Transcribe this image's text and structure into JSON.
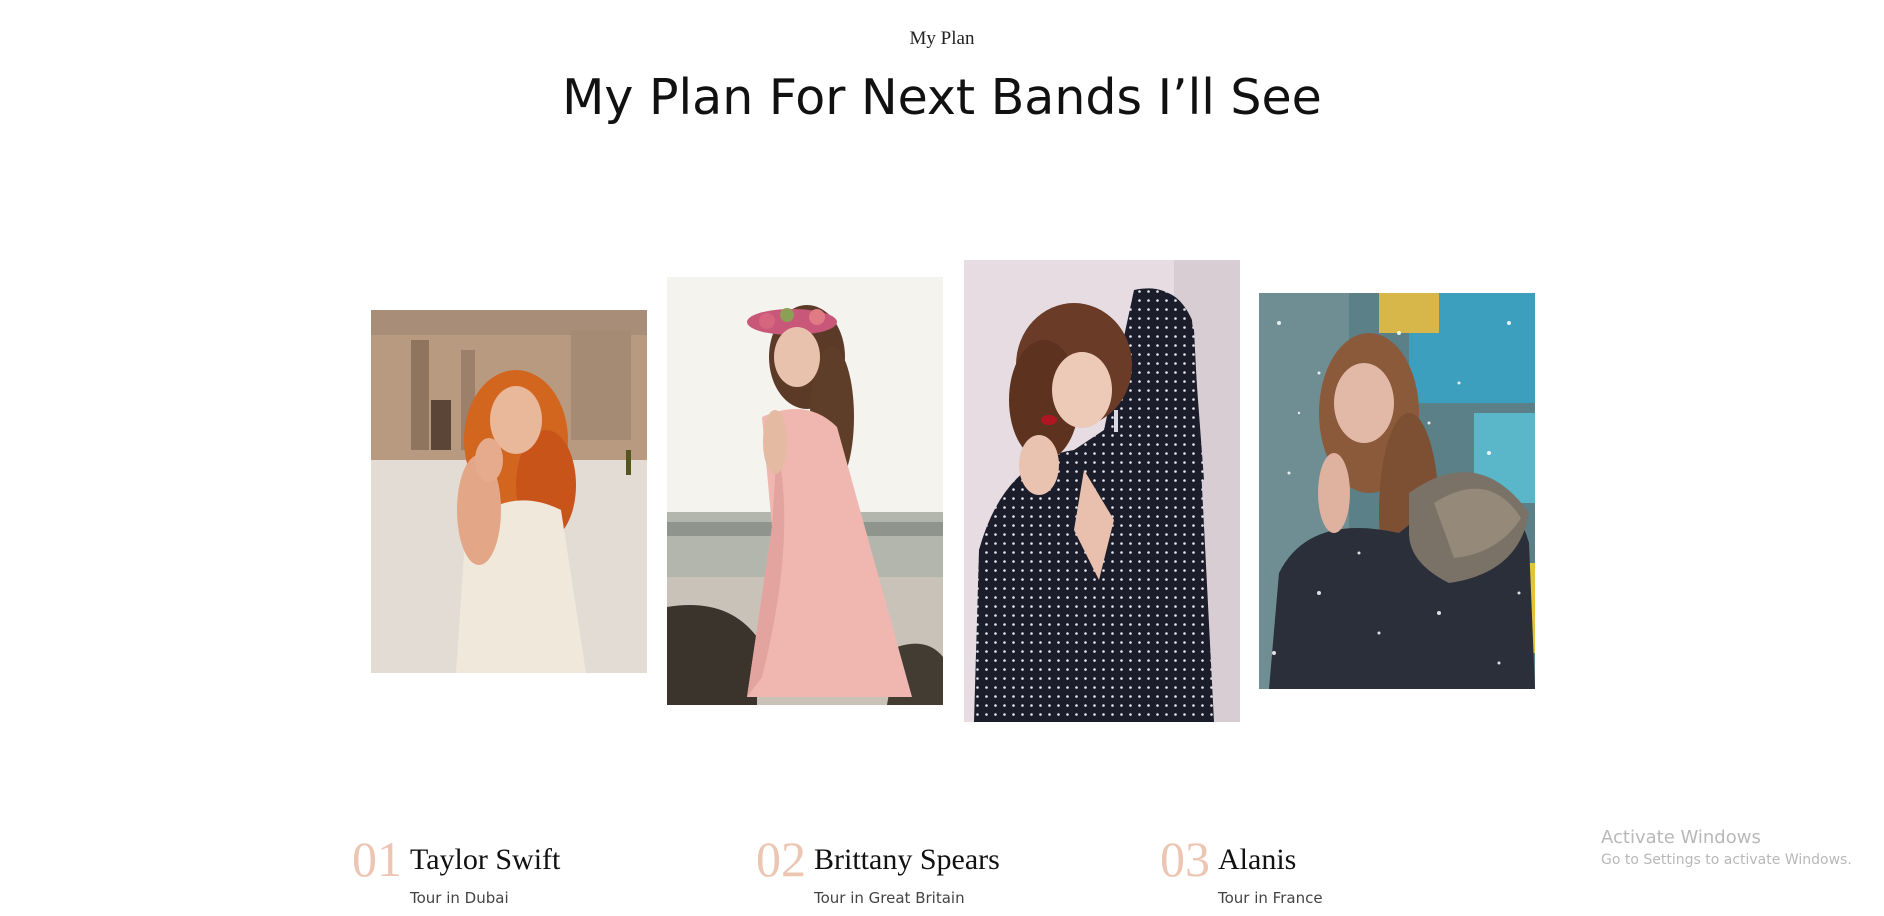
{
  "section": {
    "eyebrow": "My Plan",
    "title": "My Plan For Next Bands I’ll See"
  },
  "gallery": [
    {
      "id": "photo-1",
      "alt": "Woman with red hair in white dress in plaza"
    },
    {
      "id": "photo-2",
      "alt": "Woman in pink dress with flower crown at beach"
    },
    {
      "id": "photo-3",
      "alt": "Woman in polka dot blouse"
    },
    {
      "id": "photo-4",
      "alt": "Woman in fur-collared jacket in snow"
    }
  ],
  "bands": [
    {
      "number": "01",
      "name": "Taylor Swift",
      "tour": "Tour in Dubai"
    },
    {
      "number": "02",
      "name": "Brittany Spears",
      "tour": "Tour in Great Britain"
    },
    {
      "number": "03",
      "name": "Alanis",
      "tour": "Tour in France"
    }
  ],
  "watermark": {
    "title": "Activate Windows",
    "subtitle": "Go to Settings to activate Windows."
  },
  "colors": {
    "accent_number": "#ecc6b3",
    "heading": "#111111",
    "background": "#ffffff"
  }
}
